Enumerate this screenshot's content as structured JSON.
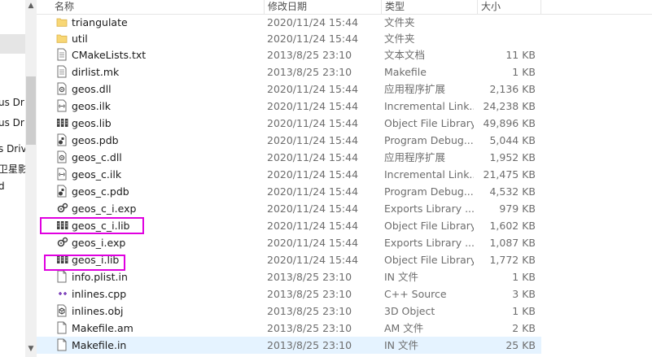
{
  "nav": {
    "items": [
      "us Dri",
      "us Driv",
      "s Driv",
      "卫星影",
      "d"
    ]
  },
  "columns": {
    "name": "名称",
    "date": "修改日期",
    "type": "类型",
    "size": "大小"
  },
  "files": [
    {
      "name": "triangulate",
      "date": "2020/11/24 15:44",
      "type": "文件夹",
      "size": "",
      "icon": "folder-icon"
    },
    {
      "name": "util",
      "date": "2020/11/24 15:44",
      "type": "文件夹",
      "size": "",
      "icon": "folder-icon"
    },
    {
      "name": "CMakeLists.txt",
      "date": "2013/8/25 23:10",
      "type": "文本文档",
      "size": "11 KB",
      "icon": "text-file-icon"
    },
    {
      "name": "dirlist.mk",
      "date": "2013/8/25 23:10",
      "type": "Makefile",
      "size": "1 KB",
      "icon": "text-file-icon"
    },
    {
      "name": "geos.dll",
      "date": "2020/11/24 15:44",
      "type": "应用程序扩展",
      "size": "2,136 KB",
      "icon": "dll-file-icon"
    },
    {
      "name": "geos.ilk",
      "date": "2020/11/24 15:44",
      "type": "Incremental Link...",
      "size": "24,238 KB",
      "icon": "ilk-file-icon"
    },
    {
      "name": "geos.lib",
      "date": "2020/11/24 15:44",
      "type": "Object File Library",
      "size": "49,896 KB",
      "icon": "lib-file-icon"
    },
    {
      "name": "geos.pdb",
      "date": "2020/11/24 15:44",
      "type": "Program Debug...",
      "size": "5,044 KB",
      "icon": "pdb-file-icon"
    },
    {
      "name": "geos_c.dll",
      "date": "2020/11/24 15:44",
      "type": "应用程序扩展",
      "size": "1,952 KB",
      "icon": "dll-file-icon"
    },
    {
      "name": "geos_c.ilk",
      "date": "2020/11/24 15:44",
      "type": "Incremental Link...",
      "size": "21,475 KB",
      "icon": "ilk-file-icon"
    },
    {
      "name": "geos_c.pdb",
      "date": "2020/11/24 15:44",
      "type": "Program Debug...",
      "size": "4,532 KB",
      "icon": "pdb-file-icon"
    },
    {
      "name": "geos_c_i.exp",
      "date": "2020/11/24 15:44",
      "type": "Exports Library ...",
      "size": "979 KB",
      "icon": "exp-file-icon"
    },
    {
      "name": "geos_c_i.lib",
      "date": "2020/11/24 15:44",
      "type": "Object File Library",
      "size": "1,602 KB",
      "icon": "lib-file-icon"
    },
    {
      "name": "geos_i.exp",
      "date": "2020/11/24 15:44",
      "type": "Exports Library ...",
      "size": "1,087 KB",
      "icon": "exp-file-icon"
    },
    {
      "name": "geos_i.lib",
      "date": "2020/11/24 15:44",
      "type": "Object File Library",
      "size": "1,772 KB",
      "icon": "lib-file-icon"
    },
    {
      "name": "info.plist.in",
      "date": "2013/8/25 23:10",
      "type": "IN 文件",
      "size": "1 KB",
      "icon": "blank-file-icon"
    },
    {
      "name": "inlines.cpp",
      "date": "2013/8/25 23:10",
      "type": "C++ Source",
      "size": "3 KB",
      "icon": "cpp-file-icon"
    },
    {
      "name": "inlines.obj",
      "date": "2013/8/25 23:10",
      "type": "3D Object",
      "size": "1 KB",
      "icon": "obj-file-icon"
    },
    {
      "name": "Makefile.am",
      "date": "2013/8/25 23:10",
      "type": "AM 文件",
      "size": "2 KB",
      "icon": "blank-file-icon"
    },
    {
      "name": "Makefile.in",
      "date": "2013/8/25 23:10",
      "type": "IN 文件",
      "size": "25 KB",
      "icon": "blank-file-icon"
    }
  ],
  "highlight_color": "#e000e0",
  "selected_row_color": "#e5f3ff"
}
